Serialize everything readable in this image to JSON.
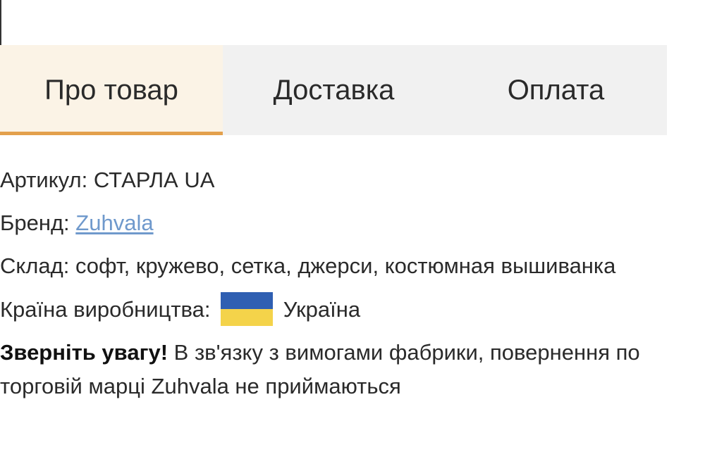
{
  "tabs": [
    {
      "label": "Про товар",
      "active": true
    },
    {
      "label": "Доставка",
      "active": false
    },
    {
      "label": "Оплата",
      "active": false
    }
  ],
  "details": {
    "article_label": "Артикул:",
    "article_value": "СТАРЛА UA",
    "brand_label": "Бренд:",
    "brand_value": "Zuhvala",
    "composition_label": "Склад:",
    "composition_value": "софт, кружево, сетка, джерси, костюмная вышиванка",
    "country_label": "Країна виробництва:",
    "country_flag_icon": "ukraine-flag-icon",
    "country_value": "Україна"
  },
  "notice": {
    "title": "Зверніть увагу!",
    "text": "В зв'язку з вимогами фабрики, повернення по торговій марці Zuhvala не приймаються"
  },
  "colors": {
    "active_tab_bg": "#fbf3e6",
    "active_tab_underline": "#e3a04c",
    "tabs_bg": "#f1f1f1",
    "link": "#6f99cc",
    "flag_blue": "#2f5fb2",
    "flag_yellow": "#f4d34a"
  }
}
